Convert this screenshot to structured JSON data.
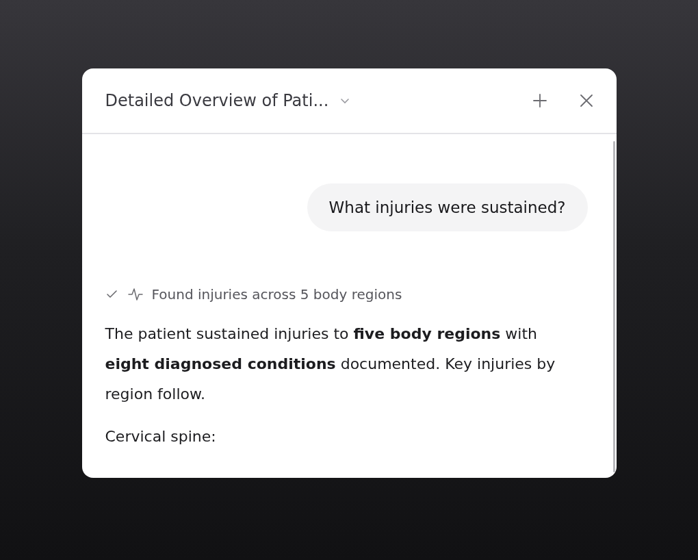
{
  "panel": {
    "title": "Detailed Overview of Pati...",
    "title_menu": {
      "expanded": false
    }
  },
  "messages": [
    {
      "kind": "user",
      "text": "What injuries were sustained?"
    },
    {
      "kind": "status",
      "completed": true,
      "text": "Found injuries across 5 body regions"
    },
    {
      "kind": "answer",
      "text": "The patient sustained injuries to **five body regions** with **eight diagnosed conditions** documented. Key injuries by region follow."
    },
    {
      "kind": "answer",
      "text": "Cervical spine:"
    }
  ]
}
